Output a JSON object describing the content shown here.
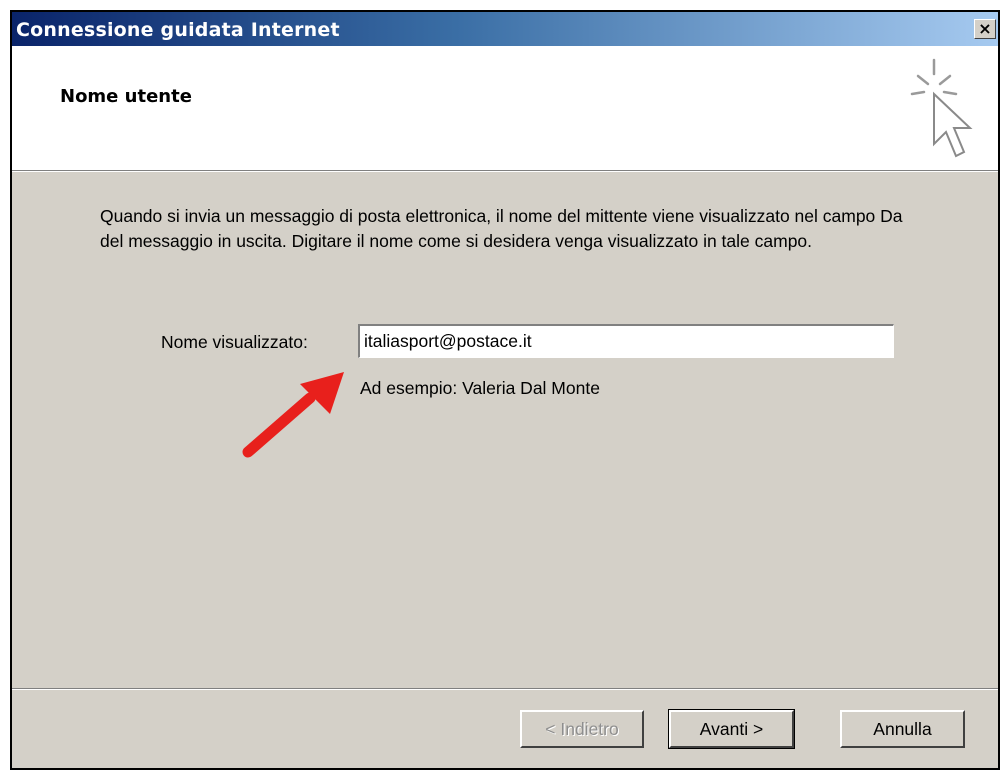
{
  "window": {
    "title": "Connessione guidata Internet",
    "close_label": "×"
  },
  "header": {
    "title": "Nome utente",
    "icon": "wizard-cursor-icon"
  },
  "body": {
    "description": "Quando si invia un messaggio di posta elettronica, il nome del mittente viene visualizzato nel campo Da del messaggio in uscita. Digitare il nome come si desidera venga visualizzato in tale campo.",
    "field_label": "Nome visualizzato:",
    "field_value": "italiasport@postace.it",
    "example": "Ad esempio: Valeria Dal Monte",
    "annotation_color": "#e8201c"
  },
  "buttons": {
    "back": "< Indietro",
    "next": "Avanti >",
    "cancel": "Annulla"
  }
}
